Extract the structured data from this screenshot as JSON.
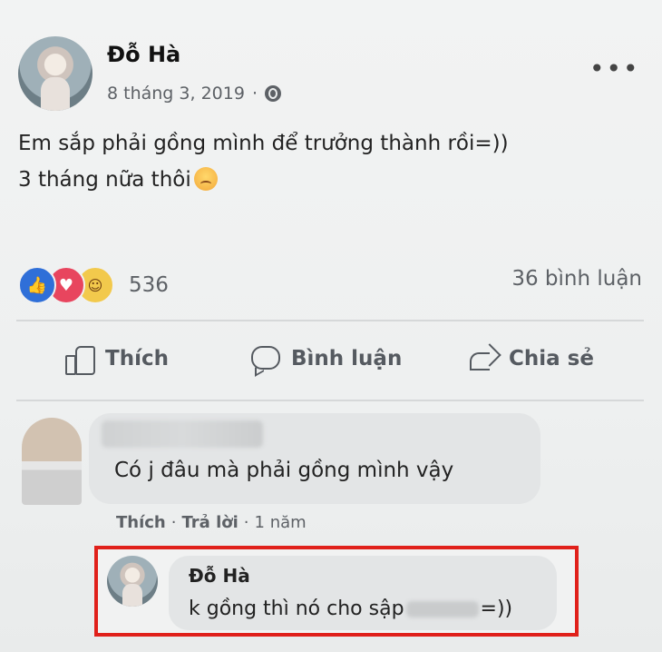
{
  "post": {
    "author": "Đỗ Hà",
    "date": "8 tháng 3, 2019",
    "separator": "·",
    "more_label": "•••",
    "text_line1": "Em sắp phải gồng mình để trưởng thành rồi=))",
    "text_line2": "3 tháng nữa thôi",
    "reaction_count": "536",
    "comment_count": "36 bình luận"
  },
  "actions": {
    "like": "Thích",
    "comment": "Bình luận",
    "share": "Chia sẻ"
  },
  "comment1": {
    "text": "Có j đâu mà phải gồng mình vậy",
    "like": "Thích",
    "dot": "·",
    "reply": "Trả lời",
    "time": "1 năm"
  },
  "reply": {
    "author": "Đỗ Hà",
    "text_before": "k gồng thì nó cho sập",
    "text_after": "=))",
    "highlight_color": "#e0201a"
  },
  "icons": {
    "reactions": [
      "like-icon",
      "love-icon",
      "haha-icon"
    ],
    "privacy": "globe-icon"
  }
}
